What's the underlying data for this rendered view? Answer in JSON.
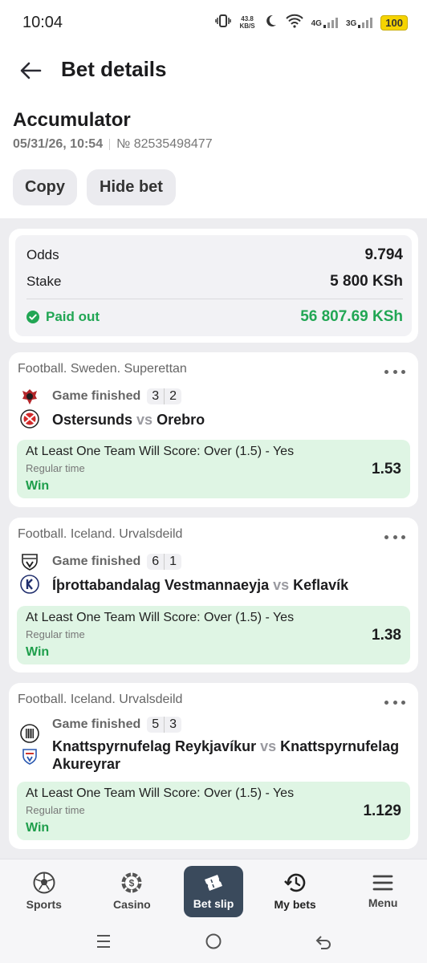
{
  "status_bar": {
    "time": "10:04",
    "speed_value": "43.8",
    "speed_unit": "KB/S",
    "net1": "4G",
    "net2": "3G",
    "battery": "100"
  },
  "header": {
    "title": "Bet details"
  },
  "bet": {
    "type": "Accumulator",
    "datetime": "05/31/26, 10:54",
    "number": "№ 82535498477"
  },
  "actions": {
    "copy": "Copy",
    "hide": "Hide bet"
  },
  "summary": {
    "odds_label": "Odds",
    "odds_value": "9.794",
    "stake_label": "Stake",
    "stake_value": "5 800 KSh",
    "paid_label": "Paid out",
    "paid_value": "56 807.69 KSh",
    "colors": {
      "paid": "#21a654"
    }
  },
  "events": [
    {
      "league": "Football. Sweden. Superettan",
      "status": "Game finished",
      "score_home": "3",
      "score_away": "2",
      "home": "Ostersunds",
      "vs": "vs",
      "away": "Orebro",
      "market": "At Least One Team Will Score: Over (1.5) - Yes",
      "period": "Regular time",
      "result": "Win",
      "odds": "1.53",
      "home_logo": "ostersunds-crest-icon",
      "away_logo": "orebro-crest-icon"
    },
    {
      "league": "Football. Iceland. Urvalsdeild",
      "status": "Game finished",
      "score_home": "6",
      "score_away": "1",
      "home": "Íþrottabandalag Vestmannaeyja",
      "vs": "vs",
      "away": "Keflavík",
      "market": "At Least One Team Will Score: Over (1.5) - Yes",
      "period": "Regular time",
      "result": "Win",
      "odds": "1.38",
      "home_logo": "ibv-crest-icon",
      "away_logo": "keflavik-crest-icon"
    },
    {
      "league": "Football. Iceland. Urvalsdeild",
      "status": "Game finished",
      "score_home": "5",
      "score_away": "3",
      "home": "Knattspyrnufelag Reykjavíkur",
      "vs": "vs",
      "away": "Knattspyrnufelag Akureyrar",
      "market": "At Least One Team Will Score: Over (1.5) - Yes",
      "period": "Regular time",
      "result": "Win",
      "odds": "1.129",
      "home_logo": "kr-crest-icon",
      "away_logo": "ka-crest-icon"
    }
  ],
  "nav": [
    {
      "label": "Sports",
      "icon": "football-icon"
    },
    {
      "label": "Casino",
      "icon": "casino-chip-icon"
    },
    {
      "label": "Bet slip",
      "icon": "ticket-icon",
      "active": true
    },
    {
      "label": "My bets",
      "icon": "history-icon"
    },
    {
      "label": "Menu",
      "icon": "hamburger-icon"
    }
  ],
  "colors": {
    "win_bg": "#dff5e4",
    "win_text": "#1e9e4b",
    "active_nav": "#3a4a5c"
  }
}
